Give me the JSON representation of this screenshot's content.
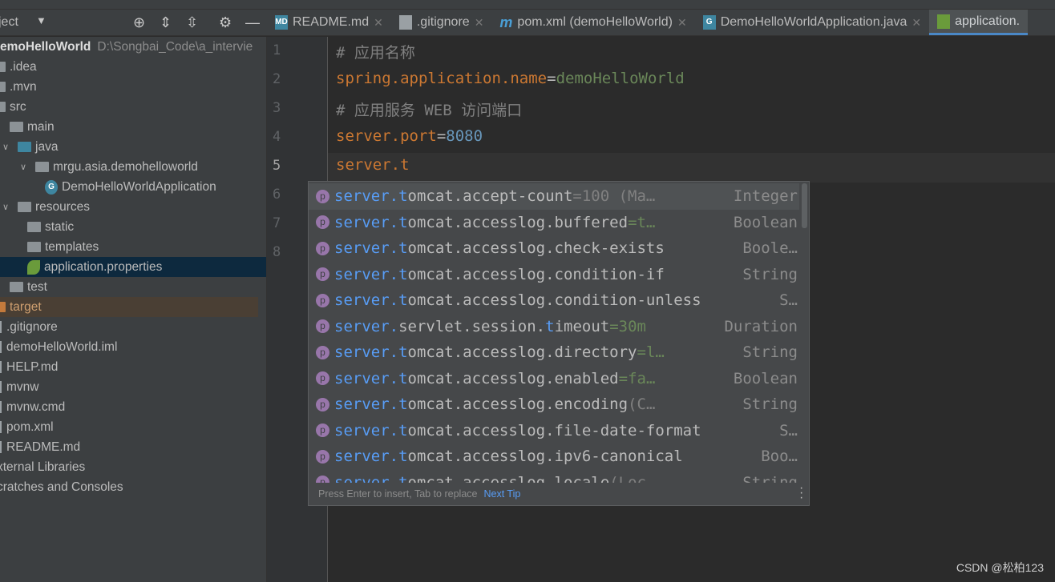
{
  "toolbar": {
    "title": "ject",
    "icons": [
      "dropdown-icon",
      "locate-icon",
      "expand-all-icon",
      "collapse-all-icon",
      "gear-icon",
      "minimize-icon"
    ]
  },
  "tabs": [
    {
      "label": "README.md",
      "icon": "MD",
      "closable": true
    },
    {
      "label": ".gitignore",
      "icon": "gitignore",
      "closable": true
    },
    {
      "label": "pom.xml (demoHelloWorld)",
      "icon": "m",
      "closable": true
    },
    {
      "label": "DemoHelloWorldApplication.java",
      "icon": "spring-boot",
      "closable": true
    },
    {
      "label": "application.",
      "icon": "spring-properties",
      "active": true
    }
  ],
  "tree": {
    "root": {
      "name": "emoHelloWorld",
      "path": "D:\\Songbai_Code\\a_intervie"
    },
    "items": [
      {
        "label": ".idea",
        "level": 0,
        "kind": "folder"
      },
      {
        "label": ".mvn",
        "level": 0,
        "kind": "folder"
      },
      {
        "label": "src",
        "level": 0,
        "kind": "folder"
      },
      {
        "label": "main",
        "level": 1,
        "kind": "folder"
      },
      {
        "label": "java",
        "level": 1,
        "kind": "folder-blue",
        "expanded": true
      },
      {
        "label": "mrgu.asia.demohelloworld",
        "level": 2,
        "kind": "package",
        "expanded": true
      },
      {
        "label": "DemoHelloWorldApplication",
        "level": 3,
        "kind": "spring-class"
      },
      {
        "label": "resources",
        "level": 1,
        "kind": "folder-res",
        "expanded": true
      },
      {
        "label": "static",
        "level": 2,
        "kind": "folder"
      },
      {
        "label": "templates",
        "level": 2,
        "kind": "folder"
      },
      {
        "label": "application.properties",
        "level": 2,
        "kind": "spring-props",
        "selected": true
      },
      {
        "label": "test",
        "level": 1,
        "kind": "folder"
      },
      {
        "label": "target",
        "level": 0,
        "kind": "folder-orange",
        "excluded": true
      },
      {
        "label": ".gitignore",
        "level": 0,
        "kind": "file"
      },
      {
        "label": "demoHelloWorld.iml",
        "level": 0,
        "kind": "file"
      },
      {
        "label": "HELP.md",
        "level": 0,
        "kind": "file"
      },
      {
        "label": "mvnw",
        "level": 0,
        "kind": "file"
      },
      {
        "label": "mvnw.cmd",
        "level": 0,
        "kind": "file"
      },
      {
        "label": "pom.xml",
        "level": 0,
        "kind": "file"
      },
      {
        "label": "README.md",
        "level": 0,
        "kind": "file"
      },
      {
        "label": "xternal Libraries",
        "level": -1,
        "kind": "none"
      },
      {
        "label": "cratches and Consoles",
        "level": -1,
        "kind": "none"
      }
    ]
  },
  "editor": {
    "current_line": 5,
    "lines": [
      {
        "n": "1",
        "parts": [
          [
            "cm",
            "# 应用名称"
          ]
        ]
      },
      {
        "n": "2",
        "parts": [
          [
            "k",
            "spring.application.name"
          ],
          [
            "eq",
            "="
          ],
          [
            "v",
            "demoHelloWorld"
          ]
        ]
      },
      {
        "n": "3",
        "parts": [
          [
            "cm",
            "# 应用服务 WEB 访问端口"
          ]
        ]
      },
      {
        "n": "4",
        "parts": [
          [
            "k",
            "server.port"
          ],
          [
            "eq",
            "="
          ],
          [
            "n",
            "8080"
          ]
        ]
      },
      {
        "n": "5",
        "parts": [
          [
            "k",
            "server.t"
          ]
        ]
      },
      {
        "n": "6",
        "parts": []
      },
      {
        "n": "7",
        "parts": []
      },
      {
        "n": "8",
        "parts": []
      }
    ]
  },
  "completion": {
    "items": [
      {
        "m": "server.t",
        "rest": "omcat.accept-count",
        "def": "=100 (Ma…",
        "defc": "def",
        "type": "Integer"
      },
      {
        "m": "server.t",
        "rest": "omcat.accesslog.buffered",
        "def": "=t…",
        "defc": "defg",
        "type": "Boolean"
      },
      {
        "m": "server.t",
        "rest": "omcat.accesslog.check-exists",
        "def": "",
        "defc": "def",
        "type": "Boole…"
      },
      {
        "m": "server.t",
        "rest": "omcat.accesslog.condition-if",
        "def": "",
        "defc": "def",
        "type": "String"
      },
      {
        "m": "server.t",
        "rest": "omcat.accesslog.condition-unless",
        "def": "",
        "defc": "def",
        "type": "S…"
      },
      {
        "m": "server.",
        "rest": "servlet.session.",
        "m2": "t",
        "rest2": "imeout",
        "def": "=30m",
        "defc": "defg",
        "type": "Duration"
      },
      {
        "m": "server.t",
        "rest": "omcat.accesslog.directory",
        "def": "=l…",
        "defc": "defg",
        "type": "String"
      },
      {
        "m": "server.t",
        "rest": "omcat.accesslog.enabled",
        "def": "=fa…",
        "defc": "defg",
        "type": "Boolean"
      },
      {
        "m": "server.t",
        "rest": "omcat.accesslog.encoding",
        "def": " (C…",
        "defc": "def",
        "type": "String"
      },
      {
        "m": "server.t",
        "rest": "omcat.accesslog.file-date-format",
        "def": "",
        "defc": "def",
        "type": "S…"
      },
      {
        "m": "server.t",
        "rest": "omcat.accesslog.ipv6-canonical",
        "def": "",
        "defc": "def",
        "type": "Boo…"
      },
      {
        "m": "server.t",
        "rest": "omcat.accesslog.locale",
        "def": " (Loc…",
        "defc": "def",
        "type": "String"
      }
    ],
    "hint": "Press Enter to insert, Tab to replace",
    "next_tip": "Next Tip"
  },
  "watermark": "CSDN @松柏123"
}
